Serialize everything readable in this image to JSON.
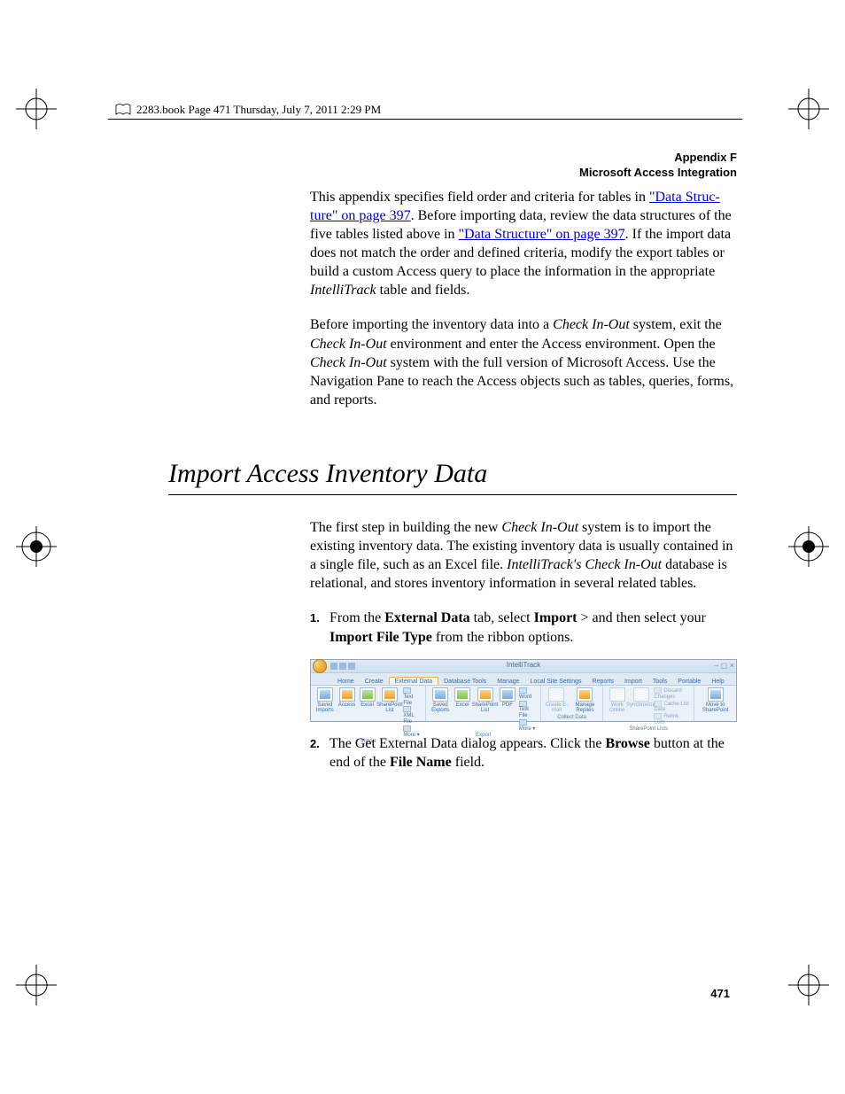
{
  "header": {
    "book_line": "2283.book  Page 471  Thursday, July 7, 2011  2:29 PM"
  },
  "appendix": {
    "line1": "Appendix F",
    "line2": "Microsoft Access Integration"
  },
  "intro": {
    "t1": "This appendix specifies field order and criteria for tables in ",
    "link1a": "\"Data Struc-",
    "link1b": "ture\" on page 397",
    "t2": ". Before importing data, review the data structures of the five tables listed above in ",
    "link2": "\"Data Structure\" on page 397",
    "t3": ". If the import data does not match the order and defined criteria, modify the export tables or build a custom Access query to place the information in the appropriate ",
    "italic1": "IntelliTrack",
    "t4": " table and fields."
  },
  "intro2": {
    "t1": "Before importing the inventory data into a ",
    "i1": "Check In-Out",
    "t2": " system, exit the ",
    "i2": "Check In-Out",
    "t3": " environment and enter the Access environment. Open the ",
    "i3": "Check In-Out",
    "t4": " system with the full version of Microsoft Access. Use the Navigation Pane to reach the Access objects such as tables, queries, forms, and reports."
  },
  "section_title": "Import Access Inventory Data",
  "section_intro": {
    "t1": "The first step in building the new ",
    "i1": "Check In-Out",
    "t2": " system is to import the existing inventory data. The existing inventory data is usually contained in a single file, such as an Excel file. ",
    "i2": "IntelliTrack's Check In-Out",
    "t3": " database is relational, and stores inventory information in several related tables."
  },
  "steps": {
    "s1": {
      "num": "1.",
      "t1": "From the ",
      "b1": "External Data",
      "t2": " tab, select ",
      "b2": "Import",
      "t3": " > and then select your ",
      "b3": "Import File Type",
      "t4": " from the ribbon options."
    },
    "s2": {
      "num": "2.",
      "t1": "The Get External Data dialog appears. Click the ",
      "b1": "Browse",
      "t2": " button at the end of the ",
      "b2": "File Name",
      "t3": " field."
    }
  },
  "ribbon": {
    "title": "IntelliTrack",
    "tabs": [
      "Home",
      "Create",
      "External Data",
      "Database Tools",
      "Manage",
      "Local Site Settings",
      "Reports",
      "Import",
      "Tools",
      "Portable",
      "Help"
    ],
    "groups": {
      "import": {
        "label": "Import",
        "items": [
          "Saved Imports",
          "Access",
          "Excel",
          "SharePoint List"
        ],
        "extra": [
          "Text File",
          "XML File",
          "More ▾"
        ]
      },
      "export": {
        "label": "Export",
        "items": [
          "Saved Exports",
          "Excel",
          "SharePoint List",
          "PDF"
        ],
        "extra": [
          "Word",
          "Text File",
          "More ▾"
        ]
      },
      "collect": {
        "label": "Collect Data",
        "items": [
          "Create E-mail",
          "Manage Replies"
        ]
      },
      "splists": {
        "label": "SharePoint Lists",
        "items": [
          "Work Online",
          "Synchronize"
        ],
        "extra": [
          "Discard Changes",
          "Cache List Data",
          "Relink Lists"
        ]
      },
      "move": {
        "label": "",
        "items": [
          "Move to SharePoint"
        ]
      }
    }
  },
  "page_number": "471"
}
